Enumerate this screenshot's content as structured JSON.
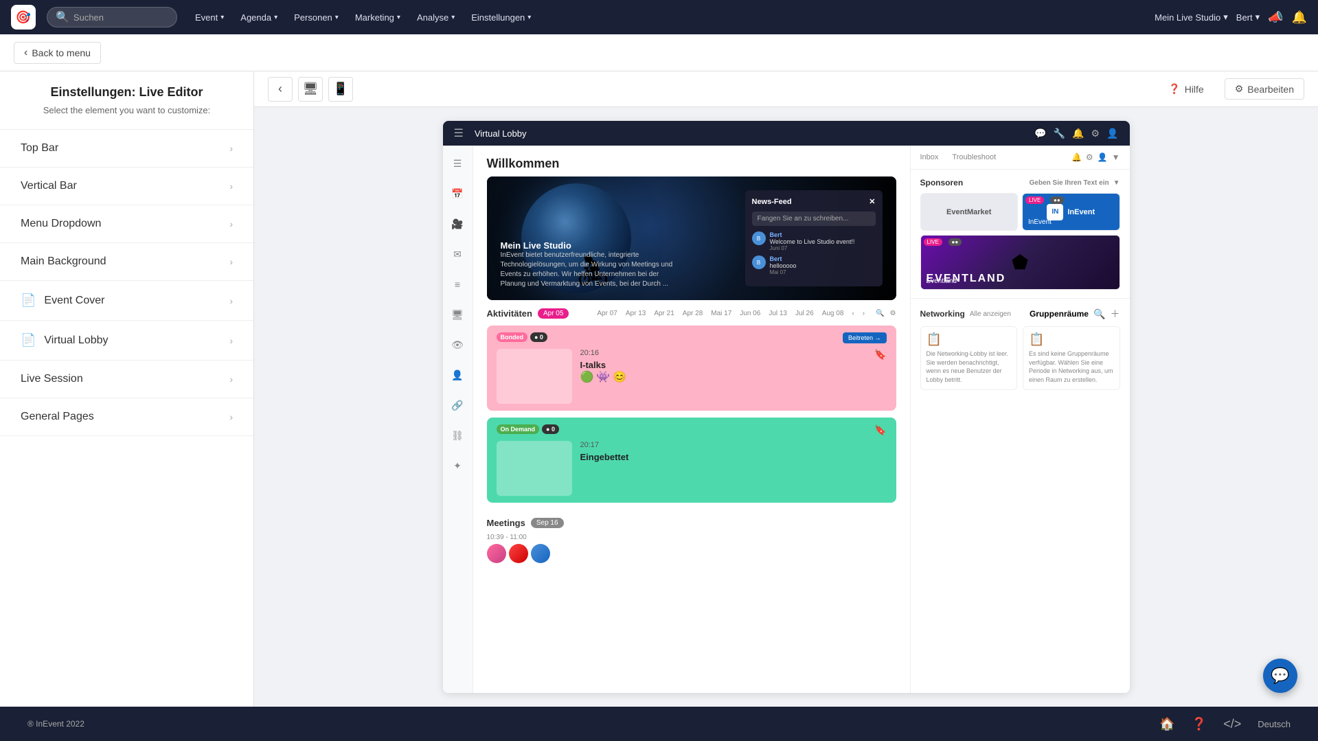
{
  "topNav": {
    "logo": "🎯",
    "searchPlaceholder": "Suchen",
    "navItems": [
      {
        "label": "Event",
        "id": "event"
      },
      {
        "label": "Agenda",
        "id": "agenda"
      },
      {
        "label": "Personen",
        "id": "personen"
      },
      {
        "label": "Marketing",
        "id": "marketing"
      },
      {
        "label": "Analyse",
        "id": "analyse"
      },
      {
        "label": "Einstellungen",
        "id": "einstellungen"
      }
    ],
    "studioLabel": "Mein Live Studio",
    "userLabel": "Bert",
    "megaphoneIcon": "📣",
    "bellIcon": "🔔"
  },
  "secondBar": {
    "backLabel": "Back to menu"
  },
  "sidebar": {
    "title": "Einstellungen: Live Editor",
    "subtitle": "Select the element you want to customize:",
    "items": [
      {
        "label": "Top Bar",
        "hasIcon": false
      },
      {
        "label": "Vertical Bar",
        "hasIcon": false
      },
      {
        "label": "Menu Dropdown",
        "hasIcon": false
      },
      {
        "label": "Main Background",
        "hasIcon": false
      },
      {
        "label": "Event Cover",
        "hasIcon": true
      },
      {
        "label": "Virtual Lobby",
        "hasIcon": true
      },
      {
        "label": "Live Session",
        "hasIcon": false
      },
      {
        "label": "General Pages",
        "hasIcon": false
      }
    ]
  },
  "preview": {
    "helpLabel": "Hilfe",
    "editLabel": "Bearbeiten"
  },
  "lobby": {
    "title": "Virtual Lobby",
    "welcomeText": "Willkommen",
    "hero": {
      "studioName": "Mein Live Studio",
      "studioDesc": "InEvent bietet benutzerfreundliche, integrierte Technologielösungen, um die Wirkung von Meetings und Events zu erhöhen. Wir helfen Unternehmen bei der Planung und Vermarktung von Events, bei der Durch ..."
    },
    "newsFeed": {
      "title": "News-Feed",
      "placeholder": "Fangen Sie an zu schreiben...",
      "messages": [
        {
          "user": "Bert",
          "text": "Welcome to Live Studio event!!",
          "time": "Juni 07"
        },
        {
          "user": "Bert",
          "text": "hellooooo",
          "time": "Mai 07"
        }
      ]
    },
    "activities": {
      "title": "Aktivitäten",
      "dateChip": "Apr 05",
      "dates": [
        "Apr 07",
        "Apr 13",
        "Apr 21",
        "Apr 28",
        "Mai 17",
        "Jun 06",
        "Jul 13",
        "Jul 26",
        "Aug 08"
      ],
      "cards": [
        {
          "badge": "Bonded",
          "badgeType": "bonded",
          "liveCount": "0",
          "time": "20:16",
          "name": "I-talks",
          "color": "pink",
          "avatars": [
            "🟢",
            "👾",
            "😊"
          ]
        },
        {
          "badge": "On Demand",
          "badgeType": "on-demand",
          "liveCount": "0",
          "time": "20:17",
          "name": "Eingebettet",
          "color": "green",
          "avatars": []
        }
      ]
    },
    "meetings": {
      "title": "Meetings",
      "dateChip": "Sep 16",
      "time": "10:39 - 11:00"
    },
    "rightPanel": {
      "inboxLabel": "Inbox",
      "troubleshootLabel": "Troubleshoot",
      "sponsorsTitle": "Sponsoren",
      "inputPlaceholder": "Geben Sie Ihren Text ein",
      "sponsors": [
        {
          "name": "EventMarket",
          "type": "eventmarket"
        },
        {
          "name": "InEvent",
          "type": "inevent"
        },
        {
          "name": "Eventland",
          "type": "eventland"
        }
      ],
      "networkingTitle": "Networking",
      "allLabel": "Alle anzeigen",
      "groupTitle": "Gruppenräume",
      "networkingEmpty": "Die Networking-Lobby ist leer. Sie werden benachrichtigt, wenn es neue Benutzer der Lobby betritt.",
      "groupEmpty": "Es sind keine Gruppenräume verfügbar. Wählen Sie eine Periode in Networking aus, um einen Raum zu erstellen."
    }
  },
  "footer": {
    "copyright": "® InEvent 2022",
    "lang": "Deutsch"
  },
  "colors": {
    "navBg": "#1a2035",
    "accent": "#e91e8c",
    "blue": "#1565c0"
  }
}
